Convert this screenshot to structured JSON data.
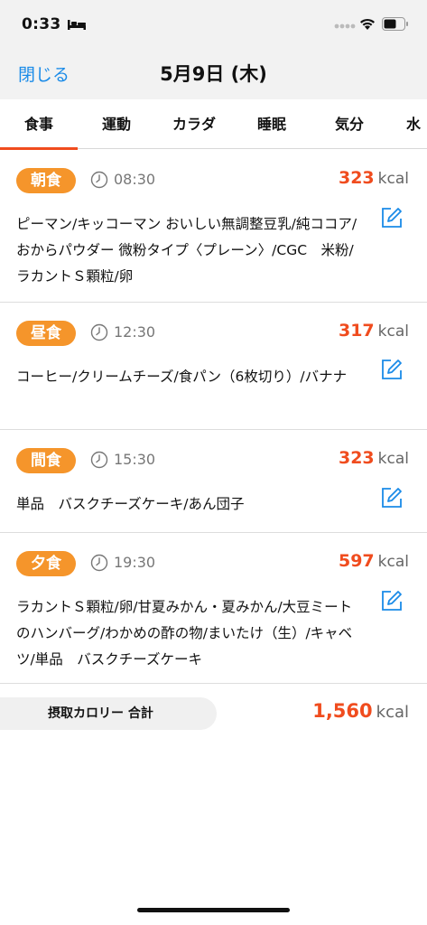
{
  "status": {
    "time": "0:33"
  },
  "nav": {
    "close_label": "閉じる",
    "title": "5月9日 (木)"
  },
  "tabs": [
    {
      "label": "食事"
    },
    {
      "label": "運動"
    },
    {
      "label": "カラダ"
    },
    {
      "label": "睡眠"
    },
    {
      "label": "気分"
    },
    {
      "label": "水"
    }
  ],
  "meals": [
    {
      "label": "朝食",
      "time": "08:30",
      "kcal": "323",
      "unit": "kcal",
      "foods": "ピーマン/キッコーマン おいしい無調整豆乳/純ココア/おからパウダー 微粉タイプ〈プレーン〉/CGC　米粉/ラカントＳ顆粒/卵"
    },
    {
      "label": "昼食",
      "time": "12:30",
      "kcal": "317",
      "unit": "kcal",
      "foods": "コーヒー/クリームチーズ/食パン（6枚切り）/バナナ"
    },
    {
      "label": "間食",
      "time": "15:30",
      "kcal": "323",
      "unit": "kcal",
      "foods": "単品　バスクチーズケーキ/あん団子"
    },
    {
      "label": "夕食",
      "time": "19:30",
      "kcal": "597",
      "unit": "kcal",
      "foods": "ラカントＳ顆粒/卵/甘夏みかん・夏みかん/大豆ミートのハンバーグ/わかめの酢の物/まいたけ（生）/キャベツ/単品　バスクチーズケーキ"
    }
  ],
  "total": {
    "label": "摂取カロリー 合計",
    "kcal": "1,560",
    "unit": "kcal"
  },
  "colors": {
    "accent": "#f04c1e",
    "badge": "#f5952b",
    "link": "#1a8be8"
  }
}
